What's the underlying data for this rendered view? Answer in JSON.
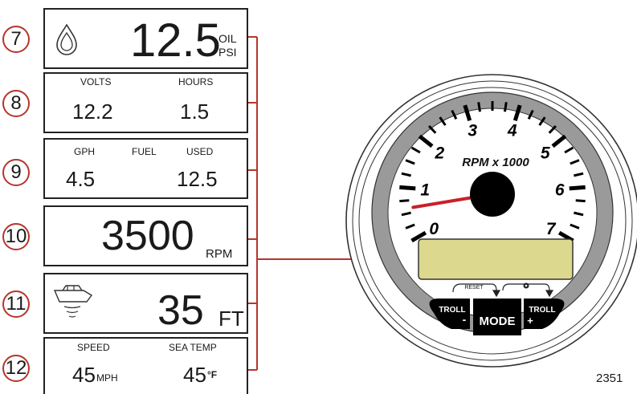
{
  "panels": {
    "oil": {
      "value": "12.5",
      "unit_top": "OIL",
      "unit_bottom": "PSI",
      "icon": "oil-drop-icon"
    },
    "volts_hours": {
      "label_left": "VOLTS",
      "label_right": "HOURS",
      "value_left": "12.2",
      "value_right": "1.5"
    },
    "fuel": {
      "label_left": "GPH",
      "label_mid": "FUEL",
      "label_right": "USED",
      "value_left": "4.5",
      "value_right": "12.5"
    },
    "rpm": {
      "value": "3500",
      "unit": "RPM"
    },
    "depth": {
      "value": "35",
      "unit": "FT",
      "icon": "boat-sonar-icon"
    },
    "speed_temp": {
      "label_left": "SPEED",
      "label_right": "SEA TEMP",
      "value_left": "45",
      "unit_left": "MPH",
      "value_right": "45",
      "unit_right": "°F"
    }
  },
  "callouts": [
    "7",
    "8",
    "9",
    "10",
    "11",
    "12"
  ],
  "gauge": {
    "dial_numbers": [
      "0",
      "1",
      "2",
      "3",
      "4",
      "5",
      "6",
      "7"
    ],
    "dial_label": "RPM x 1000",
    "reset_label": "RESET",
    "settings_icon": "gear-icon",
    "buttons": {
      "troll_minus_top": "TROLL",
      "troll_minus_sign": "-",
      "mode": "MODE",
      "troll_plus_top": "TROLL",
      "troll_plus_sign": "+"
    },
    "needle_value": 0.6
  },
  "figure_number": "2351",
  "colors": {
    "callout_ring": "#b5362b",
    "arrow": "#b5362b",
    "needle": "#c8202a",
    "lcd": "#dcd98e",
    "bezel": "#9a9a9a"
  }
}
